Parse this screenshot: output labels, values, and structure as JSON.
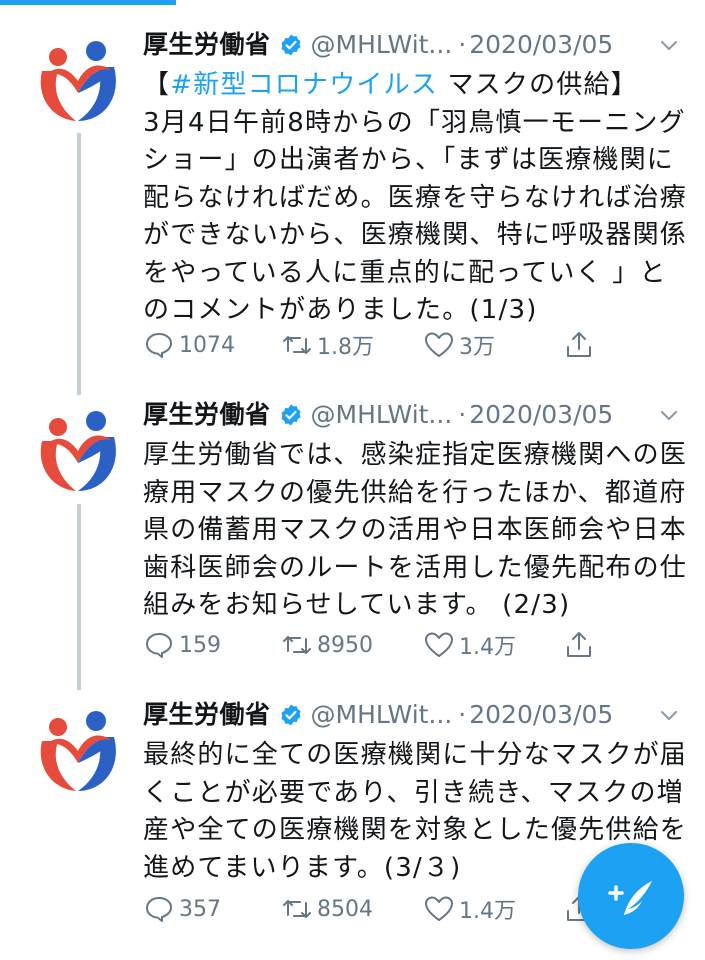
{
  "colors": {
    "accent": "#1da1f2",
    "text": "#14171a",
    "secondary": "#657786",
    "thread_line": "#c4cfd6",
    "logo_red": "#e64b3c",
    "logo_blue": "#2b61c5"
  },
  "tweets": [
    {
      "author_name": "厚生労働省",
      "handle": "@MHLWit...",
      "separator": "·",
      "date": "2020/03/05",
      "text_lines": [
        {
          "prefix": "【",
          "hashtag": "#新型コロナウイルス",
          "suffix": " マスクの供給】"
        },
        {
          "text": "3月4日午前8時からの「羽鳥慎一モーニング"
        },
        {
          "text": "ショー」の出演者から、「まずは医療機関に"
        },
        {
          "text": "配らなければだめ。医療を守らなければ治療"
        },
        {
          "text": "ができないから、医療機関、特に呼吸器関係"
        },
        {
          "text": "をやっている人に重点的に配っていく 」と"
        },
        {
          "text": "のコメントがありました。(1/3)"
        }
      ],
      "replies": "1074",
      "retweets": "1.8万",
      "likes": "3万"
    },
    {
      "author_name": "厚生労働省",
      "handle": "@MHLWit...",
      "separator": "·",
      "date": "2020/03/05",
      "text_lines": [
        {
          "text": "厚生労働省では、感染症指定医療機関への医"
        },
        {
          "text": "療用マスクの優先供給を行ったほか、都道府"
        },
        {
          "text": "県の備蓄用マスクの活用や日本医師会や日本"
        },
        {
          "text": "歯科医師会のルートを活用した優先配布の仕"
        },
        {
          "text": "組みをお知らせしています。 (2/3)"
        }
      ],
      "replies": "159",
      "retweets": "8950",
      "likes": "1.4万"
    },
    {
      "author_name": "厚生労働省",
      "handle": "@MHLWit...",
      "separator": "·",
      "date": "2020/03/05",
      "text_lines": [
        {
          "text": "最終的に全ての医療機関に十分なマスクが届"
        },
        {
          "text": "くことが必要であり、引き続き、マスクの増"
        },
        {
          "text": "産や全ての医療機関を対象とした優先供給を"
        },
        {
          "text": "進めてまいります。(3/３)"
        }
      ],
      "replies": "357",
      "retweets": "8504",
      "likes": "1.4万"
    }
  ],
  "icons": {
    "avatar": "mhlw-logo-icon",
    "verified": "verified-badge-icon",
    "caret": "chevron-down-icon",
    "reply": "reply-icon",
    "retweet": "retweet-icon",
    "like": "heart-icon",
    "share": "share-icon",
    "compose": "compose-tweet-icon"
  }
}
